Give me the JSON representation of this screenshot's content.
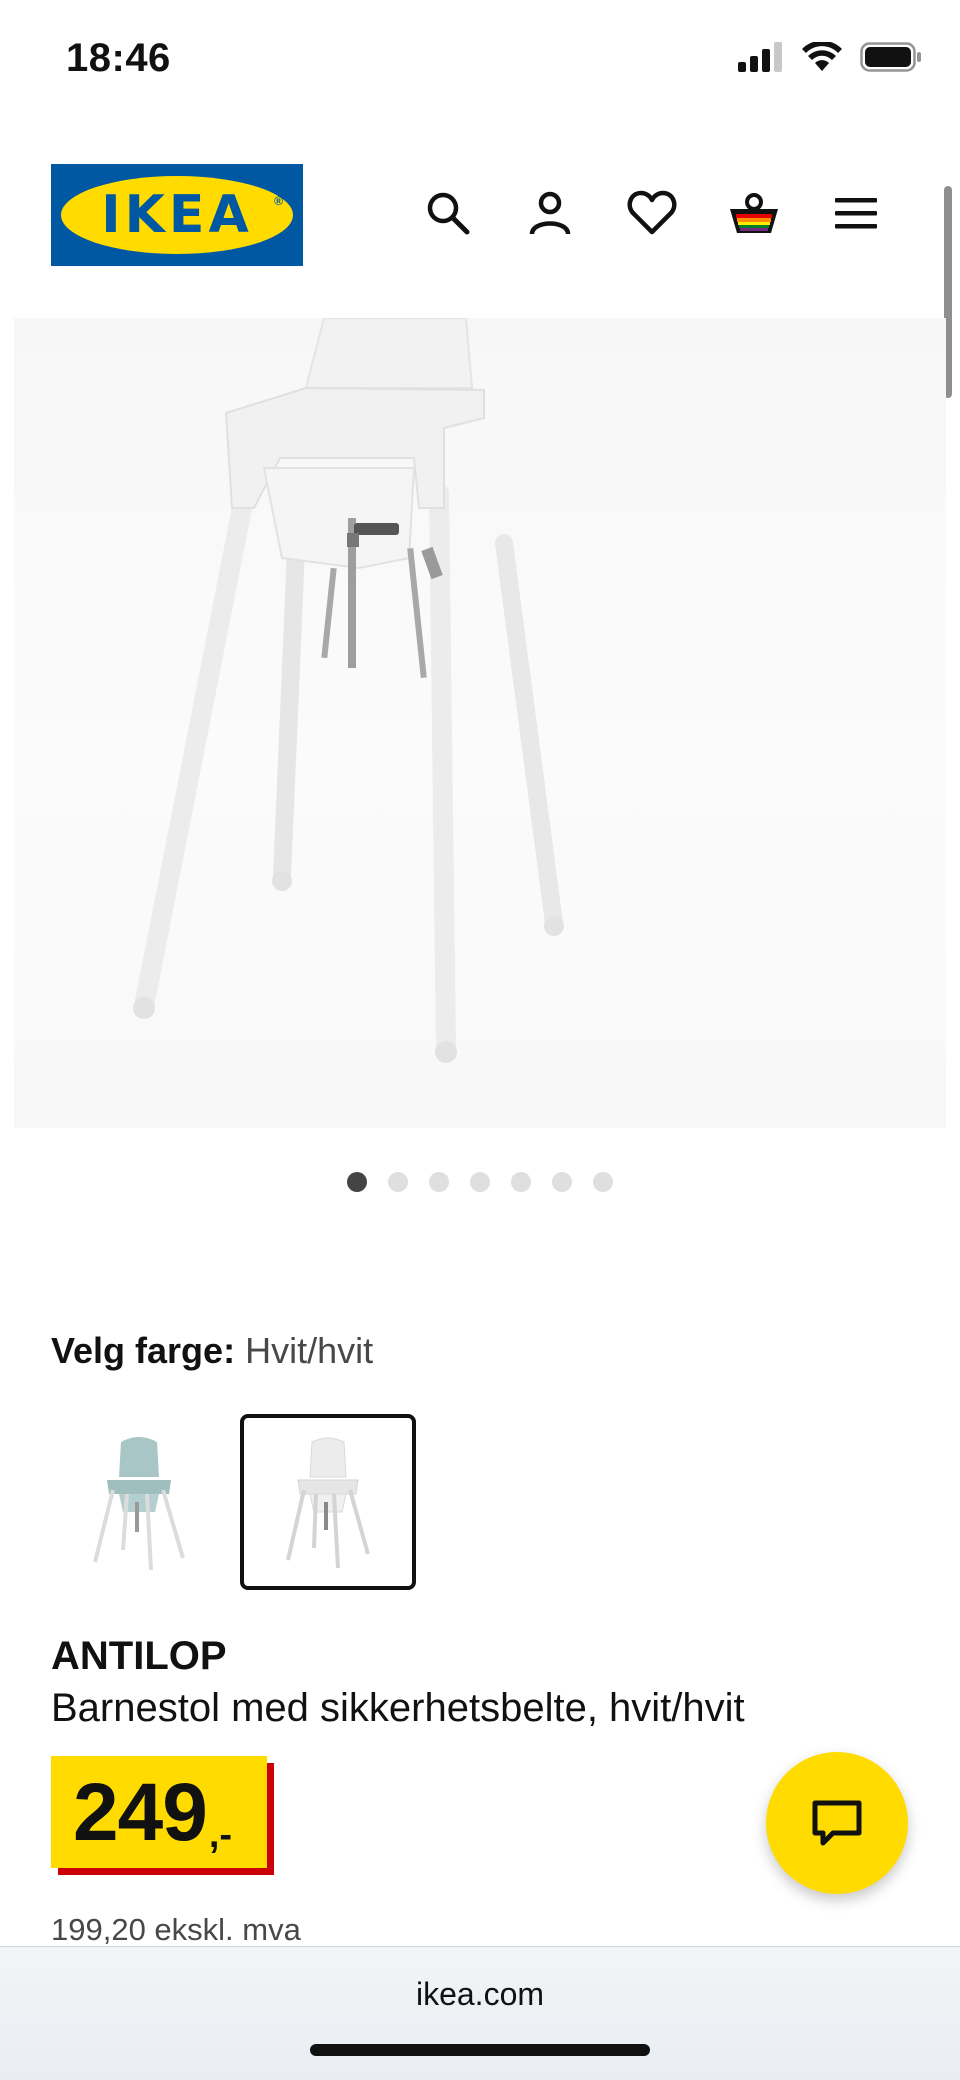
{
  "status_bar": {
    "time": "18:46",
    "icons": [
      "signal-icon",
      "wifi-icon",
      "battery-icon"
    ]
  },
  "header": {
    "logo_text": "IKEA",
    "icons": [
      "search-icon",
      "account-icon",
      "heart-icon",
      "cart-icon",
      "menu-icon"
    ]
  },
  "gallery": {
    "image_count": 7,
    "active_index": 0
  },
  "color_select": {
    "label": "Velg farge:",
    "value": "Hvit/hvit",
    "options": [
      {
        "name": "turkis/hvit",
        "selected": false
      },
      {
        "name": "hvit/hvit",
        "selected": true
      }
    ]
  },
  "product": {
    "name": "ANTILOP",
    "description": "Barnestol med sikkerhetsbelte, hvit/hvit",
    "price": "249",
    "price_suffix": ",-",
    "price_excl_vat": "199,20 ekskl. mva"
  },
  "browser": {
    "url": "ikea.com"
  },
  "colors": {
    "ikea_blue": "#0058a3",
    "ikea_yellow": "#ffdb00",
    "price_red": "#cc0008"
  }
}
